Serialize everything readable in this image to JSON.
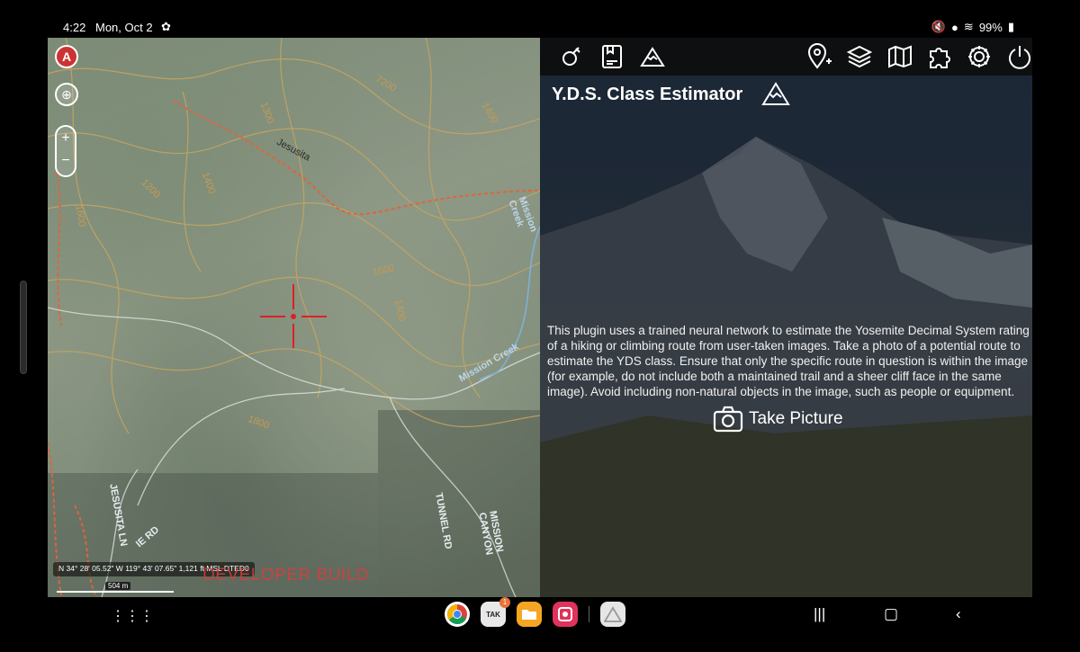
{
  "status_bar": {
    "time": "4:22",
    "date": "Mon, Oct 2",
    "battery": "99%"
  },
  "map": {
    "contour_labels": [
      "7200",
      "1300",
      "1400",
      "1400",
      "1200",
      "1600",
      "1400",
      "1600",
      "1800"
    ],
    "road_labels": [
      "Jesusita",
      "Mission Creek",
      "Mission Creek",
      "JESUSITA LN",
      "TUNNEL RD",
      "MISSION CANYON",
      "IE RD"
    ],
    "coords": "N 34° 28' 05.52\" W 119° 43' 07.65\"  1,121 ft MSL DTED0",
    "developer_build": "DEVELOPER BUILD",
    "scale": "504 m",
    "buttons": {
      "compass": "A",
      "zoom_in": "+",
      "zoom_out": "−"
    }
  },
  "toolbar": {
    "icons": [
      "pin-tool-icon",
      "notebook-icon",
      "mountain-icon",
      "location-add-icon",
      "layers-icon",
      "map-icon",
      "plugin-icon",
      "settings-icon",
      "power-icon",
      "menu-icon"
    ]
  },
  "panel": {
    "title": "Y.D.S. Class Estimator",
    "description": "This plugin uses a trained neural network to estimate the Yosemite Decimal System rating of a hiking or climbing route from user-taken images. Take a photo of a potential route to estimate the YDS class. Ensure that only the specific route in question is within the image (for example, do not include both a maintained trail and a sheer cliff face in the same image). Avoid including non-natural objects in the image, such as people or equipment.",
    "take_picture": "Take Picture"
  },
  "dock": {
    "badge_count": "1",
    "apps": [
      "chrome-app",
      "tak-app",
      "files-app",
      "gallery-app",
      "yds-app"
    ]
  },
  "colors": {
    "crosshair": "#e02020",
    "trail": "#e0643a",
    "contour": "#c69a54",
    "accent_badge": "#e8723a"
  }
}
